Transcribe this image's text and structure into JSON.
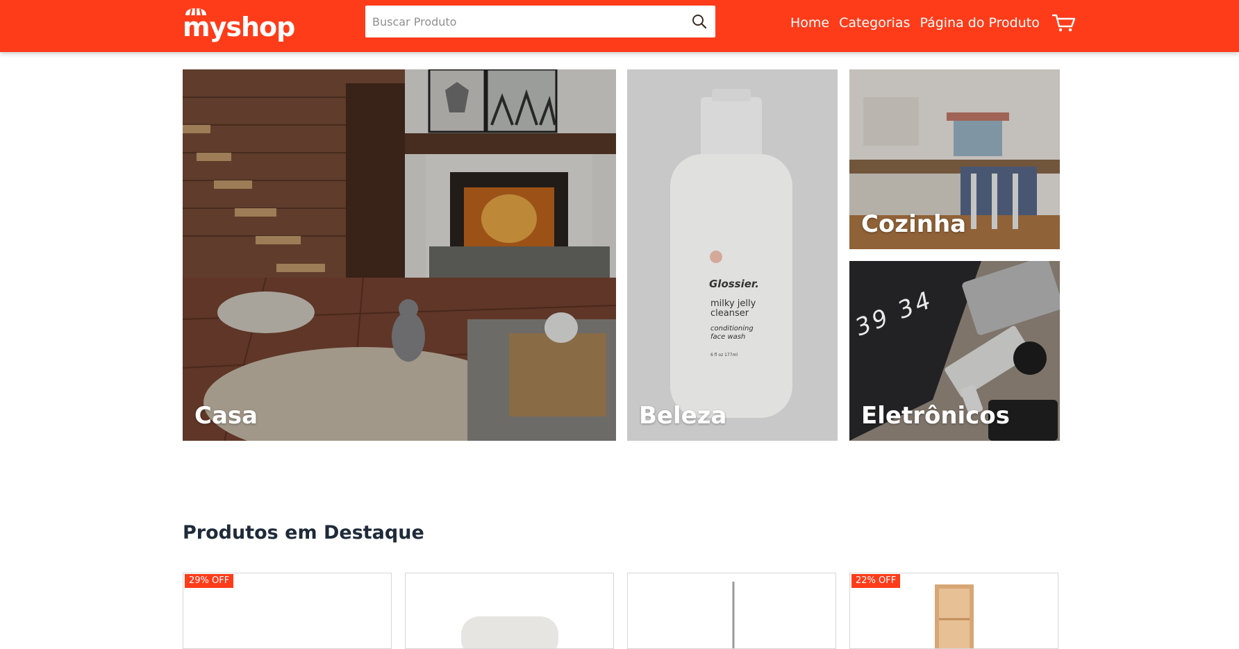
{
  "header": {
    "logo_text": "myshop",
    "search": {
      "placeholder": "Buscar Produto",
      "value": ""
    },
    "nav": [
      {
        "label": "Home"
      },
      {
        "label": "Categorias"
      },
      {
        "label": "Página do Produto"
      }
    ],
    "icons": {
      "search": "search-icon",
      "cart": "cart-icon",
      "logo": "awning-icon"
    }
  },
  "categories": [
    {
      "label": "Casa"
    },
    {
      "label": "Beleza"
    },
    {
      "label": "Cozinha"
    },
    {
      "label": "Eletrônicos"
    }
  ],
  "beleza_product": {
    "brand": "Glossier.",
    "line1": "milky jelly",
    "line2": "cleanser",
    "line3": "conditioning",
    "line4": "face wash",
    "size": "6 fl oz  177ml"
  },
  "eletronicos_clock": {
    "digits": "39 34"
  },
  "featured": {
    "title": "Produtos em Destaque",
    "products": [
      {
        "badge": "29% OFF"
      },
      {
        "badge": ""
      },
      {
        "badge": ""
      },
      {
        "badge": "22% OFF"
      }
    ]
  },
  "colors": {
    "brand": "#ff3c1a",
    "text_dark": "#1f2b3a"
  }
}
